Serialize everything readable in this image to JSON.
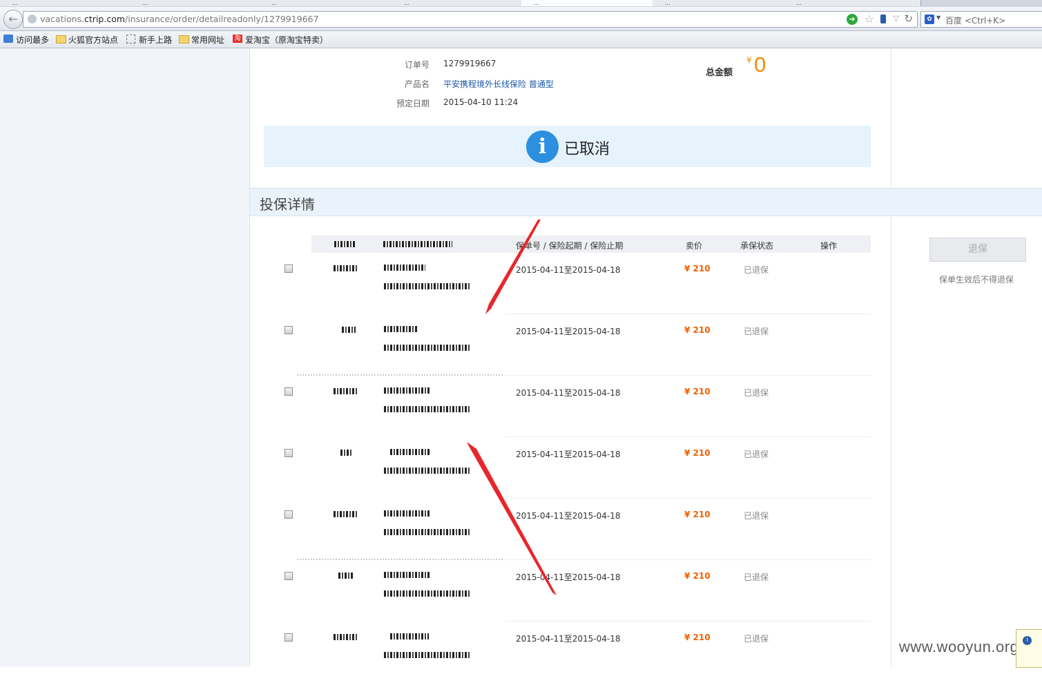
{
  "browser": {
    "tabs": [
      "...",
      "...",
      "...",
      "...",
      "...",
      "...",
      "..."
    ],
    "url_prefix": "vacations.",
    "url_domain": "ctrip.com",
    "url_path": "/insurance/order/detailreadonly/1279919667",
    "search_placeholder": "百度 <Ctrl+K>",
    "bookmarks": [
      "访问最多",
      "火狐官方站点",
      "新手上路",
      "常用网址",
      "爱淘宝（原淘宝特卖）"
    ]
  },
  "order": {
    "order_no_label": "订单号",
    "order_no": "1279919667",
    "product_label": "产品名",
    "product": "平安携程境外长线保险 普通型",
    "date_label": "预定日期",
    "date": "2015-04-10 11:24",
    "total_label": "总金额",
    "currency": "¥",
    "total": "0"
  },
  "status": {
    "icon": "info-icon",
    "text": "已取消"
  },
  "section": {
    "title": "投保详情"
  },
  "table": {
    "headers": {
      "policy": "保单号 / 保险起期 / 保险止期",
      "price": "卖价",
      "state": "承保状态",
      "ops": "操作"
    },
    "rows": [
      {
        "period": "2015-04-11至2015-04-18",
        "price": "¥ 210",
        "state": "已退保"
      },
      {
        "period": "2015-04-11至2015-04-18",
        "price": "¥ 210",
        "state": "已退保"
      },
      {
        "period": "2015-04-11至2015-04-18",
        "price": "¥ 210",
        "state": "已退保"
      },
      {
        "period": "2015-04-11至2015-04-18",
        "price": "¥ 210",
        "state": "已退保"
      },
      {
        "period": "2015-04-11至2015-04-18",
        "price": "¥ 210",
        "state": "已退保"
      },
      {
        "period": "2015-04-11至2015-04-18",
        "price": "¥ 210",
        "state": "已退保"
      },
      {
        "period": "2015-04-11至2015-04-18",
        "price": "¥ 210",
        "state": "已退保"
      }
    ]
  },
  "actions": {
    "refund_button": "退保",
    "refund_note": "保单生效后不得退保"
  },
  "watermark": "www.wooyun.org",
  "colors": {
    "accent_orange": "#f28b00",
    "status_blue": "#2c8fe0",
    "link_blue": "#1c5aa6",
    "annotation_red": "#e8262b"
  }
}
